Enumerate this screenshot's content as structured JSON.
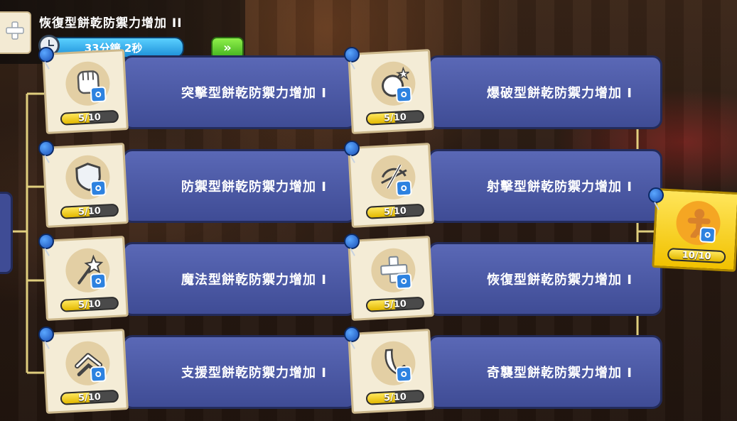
{
  "header": {
    "title": "恢復型餅乾防禦力增加 II",
    "timer": "33分鐘 2秒",
    "speedup_icon": "double-chevron-right-icon"
  },
  "nodes_left": [
    {
      "label": "突擊型餅乾防禦力增加 I",
      "progress": "5/10",
      "level": 0.5,
      "icon": "fist-icon"
    },
    {
      "label": "防禦型餅乾防禦力增加 I",
      "progress": "5/10",
      "level": 0.5,
      "icon": "shield-icon"
    },
    {
      "label": "魔法型餅乾防禦力增加 I",
      "progress": "5/10",
      "level": 0.5,
      "icon": "wand-icon"
    },
    {
      "label": "支援型餅乾防禦力增加 I",
      "progress": "5/10",
      "level": 0.5,
      "icon": "chevron-up-icon"
    }
  ],
  "nodes_right": [
    {
      "label": "爆破型餅乾防禦力增加 I",
      "progress": "5/10",
      "level": 0.5,
      "icon": "bomb-icon"
    },
    {
      "label": "射擊型餅乾防禦力增加 I",
      "progress": "5/10",
      "level": 0.5,
      "icon": "crossbow-icon"
    },
    {
      "label": "恢復型餅乾防禦力增加 I",
      "progress": "5/10",
      "level": 0.5,
      "icon": "plus-icon"
    },
    {
      "label": "奇襲型餅乾防禦力增加 I",
      "progress": "5/10",
      "level": 0.5,
      "icon": "blade-icon"
    }
  ],
  "final_node": {
    "progress": "10/10",
    "level": 1.0,
    "icon": "gingerbread-icon"
  },
  "colors": {
    "banner": "#4a57a6",
    "card": "#f4ecd6",
    "final": "#ffd92e",
    "line": "#f3e18a"
  }
}
